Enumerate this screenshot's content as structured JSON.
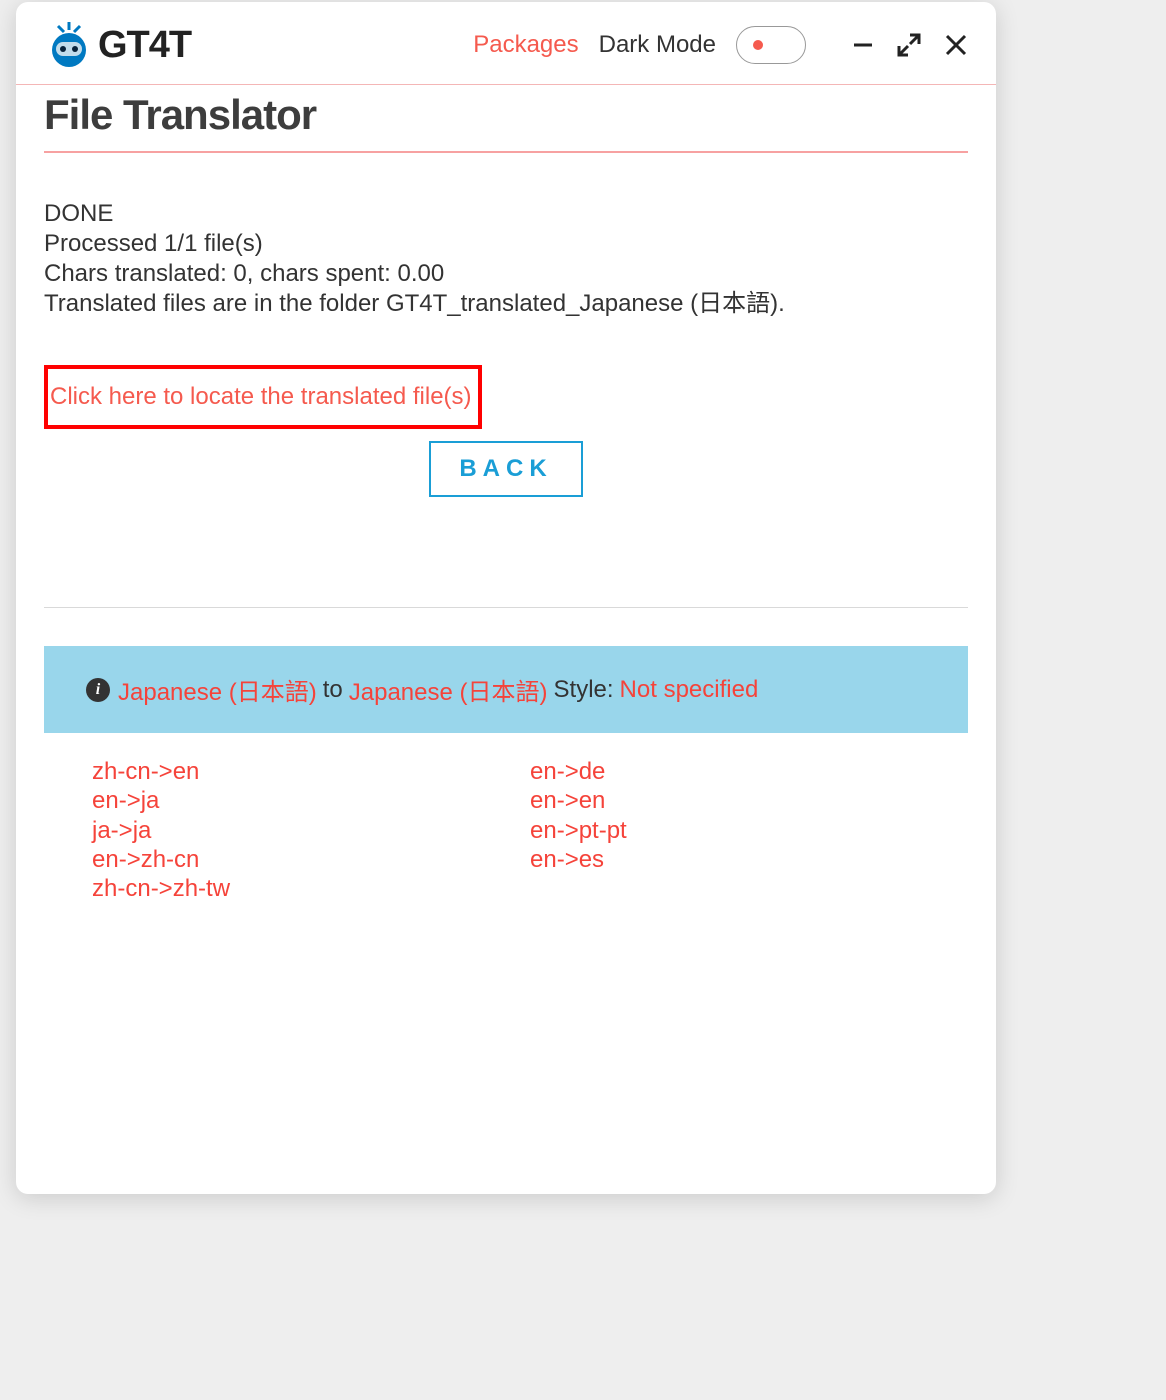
{
  "header": {
    "logo_text": "GT4T",
    "packages": "Packages",
    "dark_mode": "Dark Mode"
  },
  "page_title": "File Translator",
  "status": {
    "line1": "DONE",
    "line2": "Processed 1/1 file(s)",
    "line3": "Chars translated: 0, chars spent: 0.00",
    "line4": "Translated files are in the folder GT4T_translated_Japanese (日本語)."
  },
  "locate_link": "Click here to locate the translated file(s)",
  "back_button": "BACK",
  "info_bar": {
    "source": "Japanese (日本語)",
    "to": " to ",
    "target": "Japanese (日本語)",
    "style_label": " Style: ",
    "style": "Not specified"
  },
  "lang_pairs_left": [
    "zh-cn->en",
    "en->ja",
    "ja->ja",
    "en->zh-cn",
    "zh-cn->zh-tw"
  ],
  "lang_pairs_right": [
    "en->de",
    "en->en",
    "en->pt-pt",
    "en->es"
  ]
}
